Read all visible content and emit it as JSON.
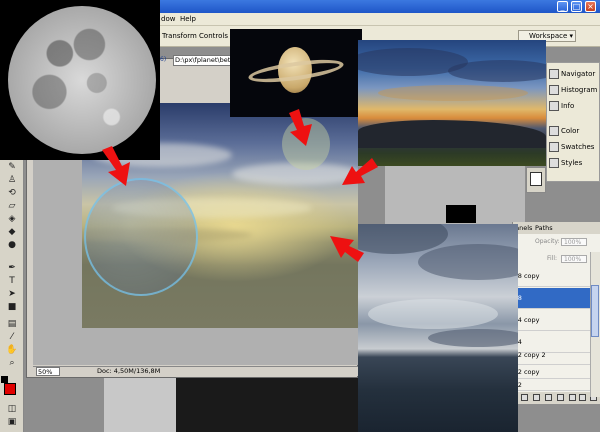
{
  "menu": {
    "window_label": "dow",
    "help_label": "Help"
  },
  "options_bar": {
    "transform_controls_label": "Transform Controls",
    "workspace_label": "Workspace ▾"
  },
  "document": {
    "path": "D:\\px\\fplanet\\beta...",
    "title_tag": "6)",
    "zoom": "50%",
    "doc_info": "Doc: 4,50M/136,8M"
  },
  "nav_panel": {
    "items": [
      {
        "label": "Navigator",
        "icon": "navigator-icon"
      },
      {
        "label": "Histogram",
        "icon": "histogram-icon"
      },
      {
        "label": "Info",
        "icon": "info-icon"
      },
      {
        "label": "Color",
        "icon": "color-icon"
      },
      {
        "label": "Swatches",
        "icon": "swatches-icon"
      },
      {
        "label": "Styles",
        "icon": "styles-icon"
      }
    ]
  },
  "layers_panel": {
    "tabs": [
      "nnels",
      "Paths"
    ],
    "opacity_label": "Opacity:",
    "opacity_value": "100%",
    "fill_label": "Fill:",
    "fill_value": "100%",
    "layers": [
      {
        "name": "r 8 copy",
        "selected": false
      },
      {
        "name": "r 8",
        "selected": true
      },
      {
        "name": "r 4 copy",
        "selected": false
      },
      {
        "name": "r 4",
        "selected": false
      },
      {
        "name": "r 2 copy 2",
        "selected": false
      },
      {
        "name": "r 2 copy",
        "selected": false
      },
      {
        "name": "r 2",
        "selected": false
      }
    ]
  },
  "colors": {
    "arrow": "#ee1111",
    "foreground_swatch": "#e00000",
    "selected_layer": "#316ac5"
  }
}
